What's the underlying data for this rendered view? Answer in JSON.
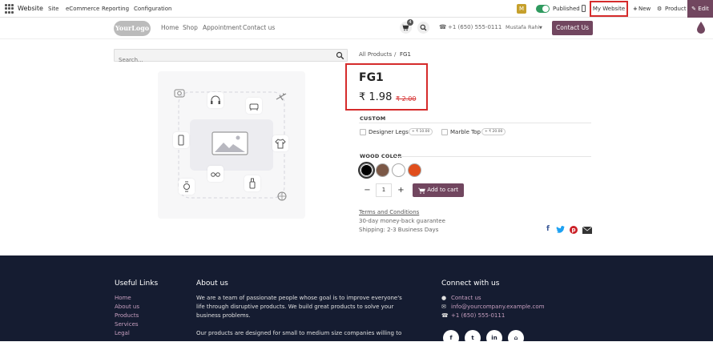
{
  "admin_bar": {
    "app_name": "Website",
    "menus": [
      "Site",
      "eCommerce",
      "Reporting",
      "Configuration"
    ],
    "avatar_letter": "M",
    "published_label": "Published",
    "website_selector": "My Website",
    "new_label": "New",
    "product_label": "Product",
    "edit_label": "Edit"
  },
  "site_nav": {
    "logo_text": "YourLogo",
    "links": [
      "Home",
      "Shop",
      "Appointment",
      "Contact us"
    ],
    "cart_count": "4",
    "phone": "+1 (650) 555-0111",
    "user": "Mustafa Rahi",
    "contact_button": "Contact Us"
  },
  "search": {
    "placeholder": "Search..."
  },
  "breadcrumb": {
    "root": "All Products",
    "separator": "/",
    "current": "FG1"
  },
  "product": {
    "name": "FG1",
    "price": "₹ 1.98",
    "old_price": "₹ 2.00",
    "custom_section": "CUSTOM",
    "options": [
      {
        "label": "Designer Legs",
        "extra": "+ ₹ 10.00"
      },
      {
        "label": "Marble Top",
        "extra": "+ ₹ 20.00"
      }
    ],
    "wood_section": "WOOD COLOR",
    "colors": [
      "#000000",
      "#7b5846",
      "#ffffff",
      "#e04e1c"
    ],
    "quantity": "1",
    "minus": "−",
    "plus": "+",
    "add_to_cart": "Add to cart",
    "terms_link": "Terms and Conditions",
    "guarantee": "30-day money-back guarantee",
    "shipping": "Shipping: 2-3 Business Days"
  },
  "footer": {
    "useful_links_title": "Useful Links",
    "useful_links": [
      "Home",
      "About us",
      "Products",
      "Services",
      "Legal"
    ],
    "about_title": "About us",
    "about_lines": [
      "We are a team of passionate people whose goal is to improve everyone's",
      "life through disruptive products. We build great products to solve your",
      "business problems.",
      "Our products are designed for small to medium size companies willing to"
    ],
    "connect_title": "Connect with us",
    "contact_label": "Contact us",
    "email": "info@yourcompany.example.com",
    "phone": "+1 (650) 555-0111",
    "social": [
      "f",
      "t",
      "in",
      "⌂"
    ]
  },
  "colors": {
    "brand": "#71465f",
    "footer_bg": "#151c31",
    "highlight": "#d52b2b",
    "published": "#2f9a5f"
  }
}
